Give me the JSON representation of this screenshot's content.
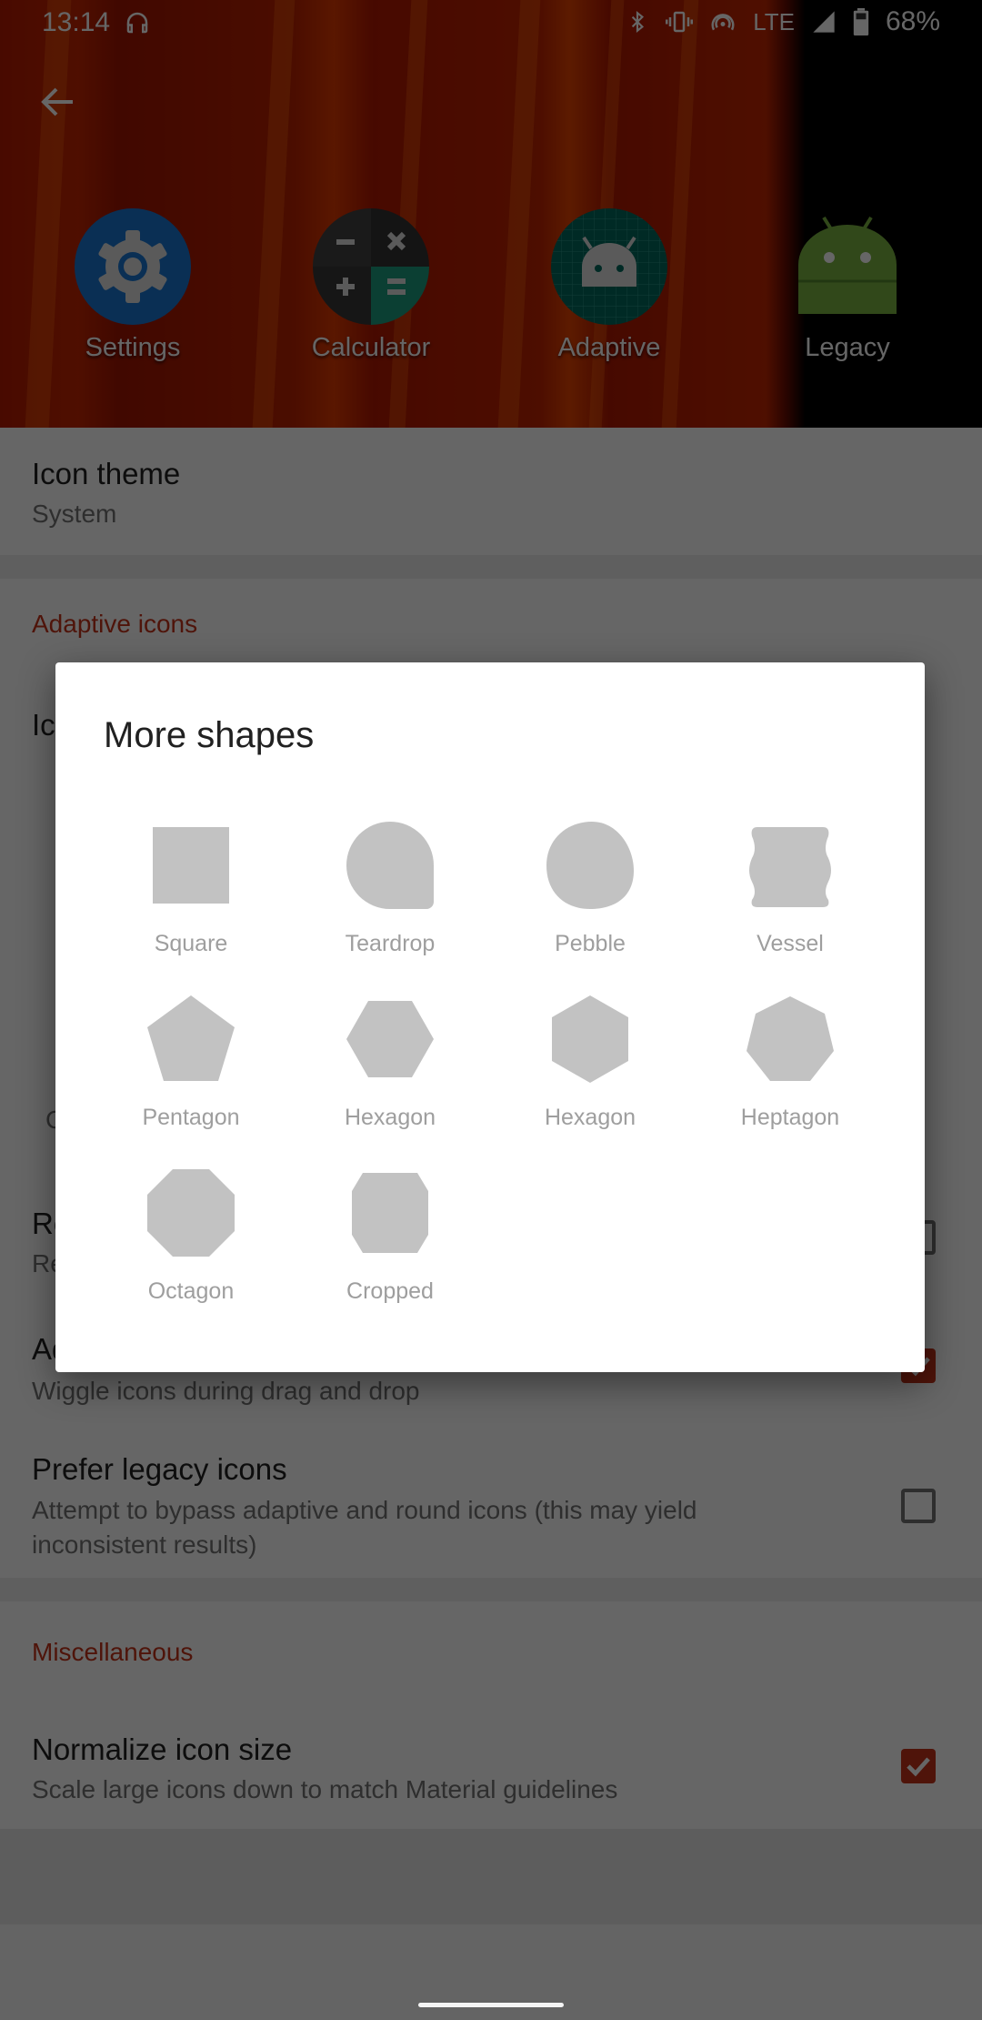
{
  "status_bar": {
    "time": "13:14",
    "left_icons": [
      "headphones-icon"
    ],
    "right_icons": [
      "bluetooth-icon",
      "vibrate-icon",
      "hotspot-icon",
      "lte-label",
      "signal-icon",
      "battery-icon"
    ],
    "network": "LTE",
    "battery": "68%"
  },
  "header": {
    "back_icon": "arrow-back-icon",
    "preview_icons": [
      {
        "label": "Settings",
        "icon": "settings-gear-icon"
      },
      {
        "label": "Calculator",
        "icon": "calculator-icon"
      },
      {
        "label": "Adaptive",
        "icon": "android-adaptive-icon"
      },
      {
        "label": "Legacy",
        "icon": "android-legacy-icon"
      }
    ]
  },
  "settings": {
    "icon_theme": {
      "title": "Icon theme",
      "value": "System"
    },
    "adaptive_section": {
      "title": "Adaptive icons",
      "partial_item_title": "Ic",
      "partial_item_letter": "C"
    },
    "reshape_item": {
      "title_partial": "Re",
      "subtitle_partial": "Re",
      "checked": false
    },
    "animate_item": {
      "title_partial": "Ad",
      "subtitle": "Wiggle icons during drag and drop",
      "checked": true
    },
    "prefer_legacy": {
      "title": "Prefer legacy icons",
      "subtitle": "Attempt to bypass adaptive and round icons (this may yield inconsistent results)",
      "checked": false
    },
    "misc_section": {
      "title": "Miscellaneous"
    },
    "normalize": {
      "title": "Normalize icon size",
      "subtitle": "Scale large icons down to match Material guidelines",
      "checked": true
    }
  },
  "dialog": {
    "title": "More shapes",
    "shapes": [
      {
        "label": "Square",
        "shape": "square"
      },
      {
        "label": "Teardrop",
        "shape": "teardrop"
      },
      {
        "label": "Pebble",
        "shape": "pebble"
      },
      {
        "label": "Vessel",
        "shape": "vessel"
      },
      {
        "label": "Pentagon",
        "shape": "pentagon"
      },
      {
        "label": "Hexagon",
        "shape": "hexagon-flat"
      },
      {
        "label": "Hexagon",
        "shape": "hexagon-pointy"
      },
      {
        "label": "Heptagon",
        "shape": "heptagon"
      },
      {
        "label": "Octagon",
        "shape": "octagon"
      },
      {
        "label": "Cropped",
        "shape": "cropped"
      }
    ]
  },
  "colors": {
    "accent": "#c5341b",
    "shape_fill": "#c2c2c2",
    "label": "#9e9e9e"
  }
}
